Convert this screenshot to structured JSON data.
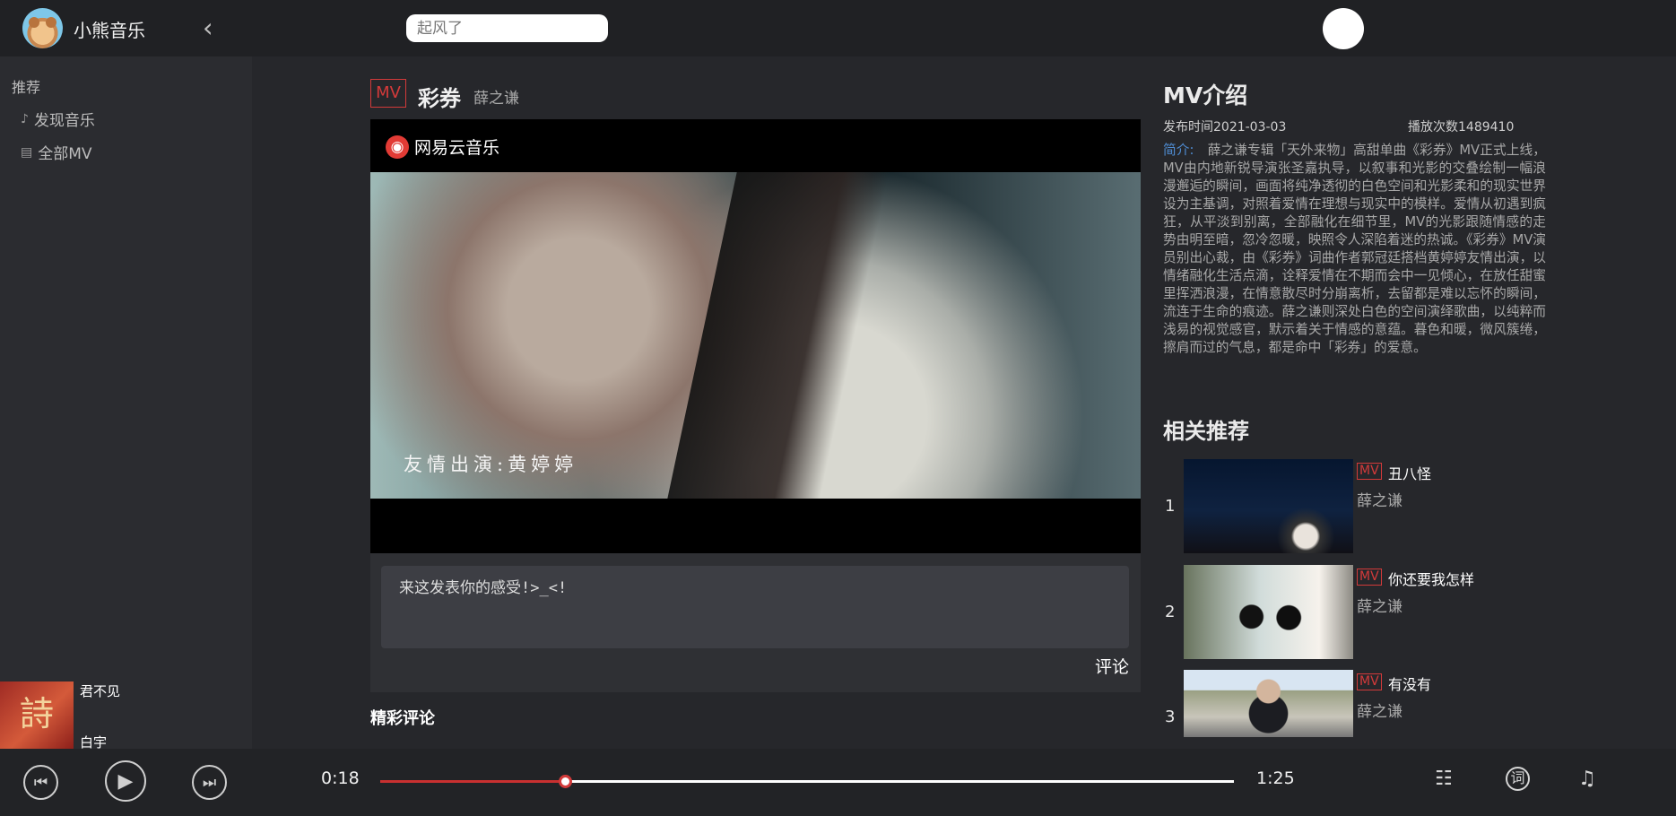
{
  "app": {
    "name": "小熊音乐"
  },
  "search": {
    "placeholder": "起风了"
  },
  "sidebar": {
    "section": "推荐",
    "items": [
      {
        "label": "发现音乐",
        "icon": "music-note-icon"
      },
      {
        "label": "全部MV",
        "icon": "document-icon"
      }
    ]
  },
  "mini_player": {
    "cover_text": "詩",
    "title": "君不见",
    "artist": "白宇"
  },
  "mv": {
    "tag": "MV",
    "title": "彩券",
    "artist": "薛之谦",
    "video_brand": "网易云音乐",
    "subtitle": "友情出演:黄婷婷"
  },
  "comments": {
    "placeholder": "来这发表你的感受!>_<!",
    "submit": "评论",
    "hot_title": "精彩评论"
  },
  "intro": {
    "title": "MV介绍",
    "publish": "发布时间2021-03-03",
    "plays": "播放次数1489410",
    "desc_label": "简介:",
    "description": "薛之谦专辑「天外来物」高甜单曲《彩券》MV正式上线，MV由内地新锐导演张圣嘉执导，以叙事和光影的交叠绘制一幅浪漫邂逅的瞬间，画面将纯净透彻的白色空间和光影柔和的现实世界设为主基调，对照着爱情在理想与现实中的模样。爱情从初遇到疯狂，从平淡到别离，全部融化在细节里，MV的光影跟随情感的走势由明至暗，忽冷忽暖，映照令人深陷着迷的热诚。《彩券》MV演员别出心裁，由《彩券》词曲作者郭冠廷搭档黄婷婷友情出演，以情绪融化生活点滴，诠释爱情在不期而会中一见倾心，在放任甜蜜里挥洒浪漫，在情意散尽时分崩离析，去留都是难以忘怀的瞬间，流连于生命的痕迹。薛之谦则深处白色的空间演绎歌曲，以纯粹而浅易的视觉感官，默示着关于情感的意蕴。暮色和暖，微风簇绻，擦肩而过的气息，都是命中「彩券」的爱意。"
  },
  "recommend": {
    "title": "相关推荐",
    "items": [
      {
        "index": "1",
        "tag": "MV",
        "title": "丑八怪",
        "artist": "薛之谦"
      },
      {
        "index": "2",
        "tag": "MV",
        "title": "你还要我怎样",
        "artist": "薛之谦"
      },
      {
        "index": "3",
        "tag": "MV",
        "title": "有没有",
        "artist": "薛之谦"
      }
    ]
  },
  "player": {
    "current_time": "0:18",
    "duration": "1:25",
    "progress": 0.216,
    "icons": [
      "previous-icon",
      "play-icon",
      "next-icon",
      "playlist-icon",
      "lyrics-icon",
      "queue-music-icon"
    ]
  },
  "colors": {
    "background": "#26272b",
    "topbar": "#202124",
    "accent_red": "#d33a3a",
    "link_blue": "#4f8dd3"
  }
}
